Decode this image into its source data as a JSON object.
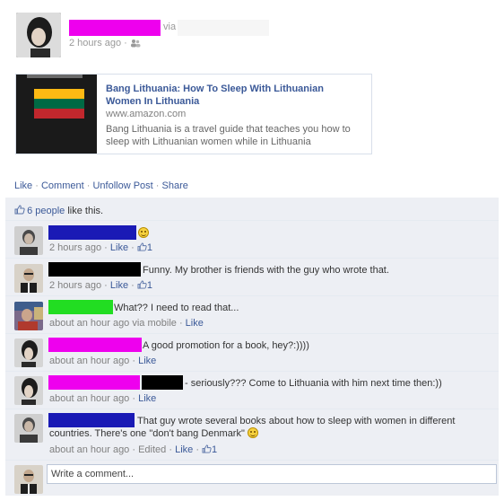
{
  "post": {
    "via_text": "via",
    "time_text": "2 hours ago",
    "separator": "·",
    "audience_icon": "friends-icon"
  },
  "share": {
    "title": "Bang Lithuania: How To Sleep With Lithuanian Women In Lithuania",
    "domain": "www.amazon.com",
    "description": "Bang Lithuania is a travel guide that teaches you how to sleep with Lithuanian women while in Lithuania",
    "flag_colors": [
      "#fdb913",
      "#006a44",
      "#c1272d"
    ]
  },
  "actions": {
    "like": "Like",
    "comment": "Comment",
    "unfollow": "Unfollow Post",
    "share": "Share",
    "dot": "·"
  },
  "likes": {
    "count_text": "6 people",
    "suffix": "like this."
  },
  "comments": [
    {
      "text": "",
      "meta": "2 hours ago",
      "like_label": "Like",
      "like_count": "1"
    },
    {
      "text": "Funny. My brother is friends with the guy who wrote that.",
      "meta": "2 hours ago",
      "like_label": "Like",
      "like_count": "1"
    },
    {
      "text": "What?? I need to read that...",
      "meta": "about an hour ago via mobile",
      "like_label": "Like"
    },
    {
      "text": "A good promotion for a book, hey?:))))",
      "meta": "about an hour ago",
      "like_label": "Like"
    },
    {
      "text": "- seriously??? Come to Lithuania with him next time then:))",
      "meta": "about an hour ago",
      "like_label": "Like"
    },
    {
      "text_line1": "That guy wrote several books about how to sleep with women in different",
      "text_line2": "countries. There's one \"don't bang Denmark\"",
      "meta": "about an hour ago",
      "edited": "Edited",
      "like_label": "Like",
      "like_count": "1"
    }
  ],
  "composer": {
    "placeholder": "Write a comment..."
  },
  "colors": {
    "link": "#3b5998",
    "panel_bg": "#edeff4",
    "redact_magenta": "#ee00ee",
    "redact_blue": "#1a1ab5",
    "redact_black": "#000000",
    "redact_green": "#22dd22"
  }
}
